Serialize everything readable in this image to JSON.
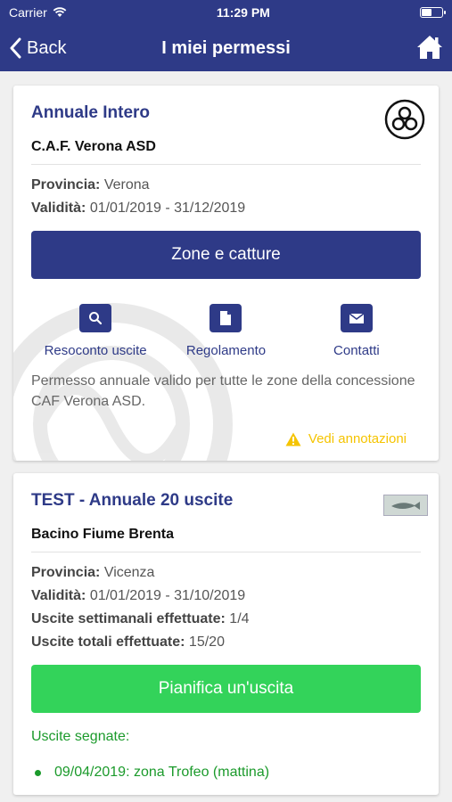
{
  "status_bar": {
    "carrier": "Carrier",
    "time": "11:29 PM",
    "battery_level": 0.55
  },
  "nav": {
    "back_label": "Back",
    "title": "I miei permessi"
  },
  "cards": [
    {
      "title": "Annuale Intero",
      "subtitle": "C.A.F. Verona ASD",
      "provincia_label": "Provincia:",
      "provincia_value": "Verona",
      "validita_label": "Validità:",
      "validita_value": "01/01/2019 - 31/12/2019",
      "button_label": "Zone e catture",
      "actions": [
        {
          "label": "Resoconto uscite",
          "icon": "search-icon"
        },
        {
          "label": "Regolamento",
          "icon": "document-icon"
        },
        {
          "label": "Contatti",
          "icon": "mail-icon"
        }
      ],
      "description": "Permesso annuale valido per tutte le zone della concessione CAF Verona ASD.",
      "annotations_label": "Vedi annotazioni"
    },
    {
      "title": "TEST - Annuale 20 uscite",
      "subtitle": "Bacino Fiume Brenta",
      "provincia_label": "Provincia:",
      "provincia_value": "Vicenza",
      "validita_label": "Validità:",
      "validita_value": "01/01/2019 - 31/10/2019",
      "settimanali_label": "Uscite settimanali effettuate:",
      "settimanali_value": "1/4",
      "totali_label": "Uscite totali effettuate:",
      "totali_value": "15/20",
      "button_label": "Pianifica un'uscita",
      "scheduled_title": "Uscite segnate:",
      "scheduled": [
        "09/04/2019: zona Trofeo (mattina)"
      ]
    }
  ],
  "colors": {
    "primary": "#2e3a87",
    "green": "#33d35a",
    "warning": "#f5c400"
  }
}
